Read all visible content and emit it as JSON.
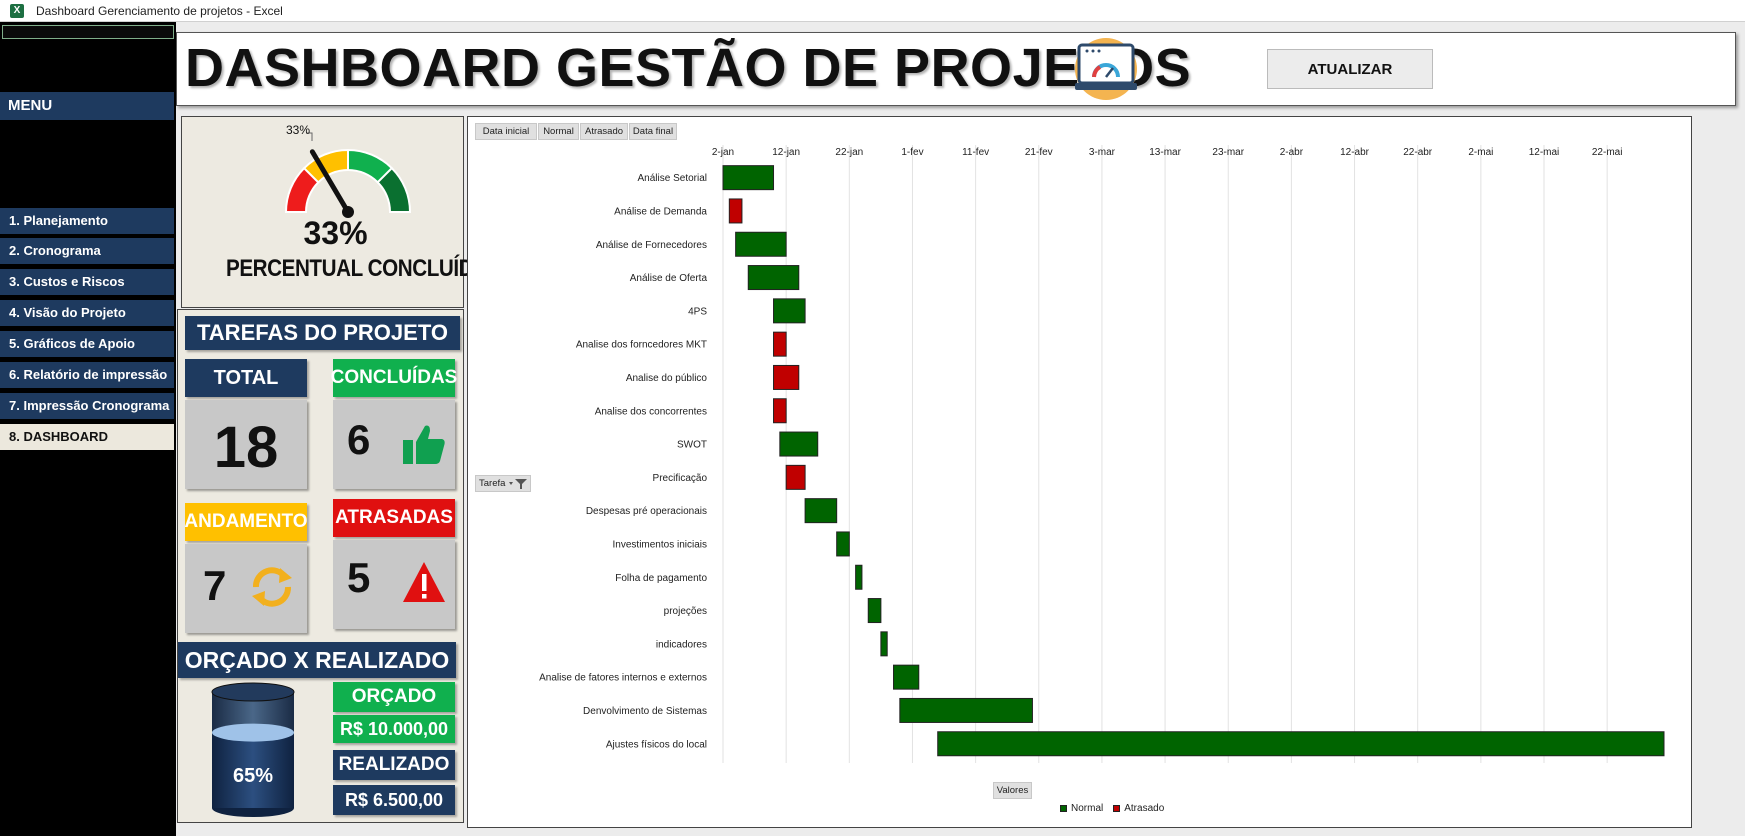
{
  "window": {
    "title": "Dashboard Gerenciamento de projetos - Excel",
    "app_icon": "X"
  },
  "sidebar": {
    "menu_label": "MENU",
    "items": [
      {
        "label": "1. Planejamento"
      },
      {
        "label": "2. Cronograma"
      },
      {
        "label": "3. Custos e Riscos"
      },
      {
        "label": "4. Visão do Projeto"
      },
      {
        "label": "5. Gráficos de Apoio"
      },
      {
        "label": "6. Relatório de impressão"
      },
      {
        "label": "7. Impressão Cronograma"
      },
      {
        "label": "8. DASHBOARD"
      }
    ]
  },
  "header": {
    "title": "DASHBOARD GESTÃO DE PROJETOS",
    "refresh_label": "ATUALIZAR"
  },
  "gauge": {
    "percent": 33,
    "percent_label": "33%",
    "value_label": "33%",
    "caption": "PERCENTUAL CONCLUÍDO"
  },
  "tasks": {
    "title": "TAREFAS DO PROJETO",
    "total_label": "TOTAL",
    "total_value": "18",
    "done_label": "CONCLUÍDAS",
    "done_value": "6",
    "progress_label": "ANDAMENTO",
    "progress_value": "7",
    "late_label": "ATRASADAS",
    "late_value": "5"
  },
  "budget": {
    "title": "ORÇADO X REALIZADO",
    "fill_percent": 65,
    "percent_label": "65%",
    "budget_label": "ORÇADO",
    "budget_value": "R$ 10.000,00",
    "actual_label": "REALIZADO",
    "actual_value": "R$ 6.500,00"
  },
  "colors": {
    "navy": "#1e3a5f",
    "green": "#10b04e",
    "yellow": "#ffc000",
    "red": "#e01010",
    "bar_normal": "#006400",
    "bar_late": "#c00000"
  },
  "chart_filters": {
    "buttons": [
      "Data inicial",
      "Normal",
      "Atrasado",
      "Data final"
    ],
    "row_field": "Tarefa",
    "values_label": "Valores"
  },
  "chart_data": {
    "type": "bar",
    "orientation": "horizontal-gantt",
    "x_ticks": [
      "2-jan",
      "12-jan",
      "22-jan",
      "1-fev",
      "11-fev",
      "21-fev",
      "3-mar",
      "13-mar",
      "23-mar",
      "2-abr",
      "12-abr",
      "22-abr",
      "2-mai",
      "12-mai",
      "22-mai"
    ],
    "x_tick_dates": [
      "2022-01-02",
      "2022-01-12",
      "2022-01-22",
      "2022-02-01",
      "2022-02-11",
      "2022-02-21",
      "2022-03-03",
      "2022-03-13",
      "2022-03-23",
      "2022-04-02",
      "2022-04-12",
      "2022-04-22",
      "2022-05-02",
      "2022-05-12",
      "2022-05-22"
    ],
    "xlim": [
      "2022-01-02",
      "2022-05-31"
    ],
    "legend": [
      "Normal",
      "Atrasado"
    ],
    "legend_position": "bottom",
    "grid": true,
    "tasks": [
      {
        "name": "Análise Setorial",
        "start": "2022-01-02",
        "end": "2022-01-10",
        "status": "Normal"
      },
      {
        "name": "Análise de Demanda",
        "start": "2022-01-03",
        "end": "2022-01-05",
        "status": "Atrasado"
      },
      {
        "name": "Análise de Fornecedores",
        "start": "2022-01-04",
        "end": "2022-01-12",
        "status": "Normal"
      },
      {
        "name": "Análise de Oferta",
        "start": "2022-01-06",
        "end": "2022-01-14",
        "status": "Normal"
      },
      {
        "name": "4PS",
        "start": "2022-01-10",
        "end": "2022-01-15",
        "status": "Normal"
      },
      {
        "name": "Analise dos forncedores MKT",
        "start": "2022-01-10",
        "end": "2022-01-12",
        "status": "Atrasado"
      },
      {
        "name": "Analise do público",
        "start": "2022-01-10",
        "end": "2022-01-14",
        "status": "Atrasado"
      },
      {
        "name": "Analise dos concorrentes",
        "start": "2022-01-10",
        "end": "2022-01-12",
        "status": "Atrasado"
      },
      {
        "name": "SWOT",
        "start": "2022-01-11",
        "end": "2022-01-17",
        "status": "Normal"
      },
      {
        "name": "Precificação",
        "start": "2022-01-12",
        "end": "2022-01-15",
        "status": "Atrasado"
      },
      {
        "name": "Despesas pré operacionais",
        "start": "2022-01-15",
        "end": "2022-01-20",
        "status": "Normal"
      },
      {
        "name": "Investimentos iniciais",
        "start": "2022-01-20",
        "end": "2022-01-22",
        "status": "Normal"
      },
      {
        "name": "Folha de pagamento",
        "start": "2022-01-23",
        "end": "2022-01-24",
        "status": "Normal"
      },
      {
        "name": "projeções",
        "start": "2022-01-25",
        "end": "2022-01-27",
        "status": "Normal"
      },
      {
        "name": "indicadores",
        "start": "2022-01-27",
        "end": "2022-01-28",
        "status": "Normal"
      },
      {
        "name": "Analise de fatores internos e externos",
        "start": "2022-01-29",
        "end": "2022-02-02",
        "status": "Normal"
      },
      {
        "name": "Denvolvimento de Sistemas",
        "start": "2022-01-30",
        "end": "2022-02-20",
        "status": "Normal"
      },
      {
        "name": "Ajustes físicos do local",
        "start": "2022-02-05",
        "end": "2022-05-31",
        "status": "Normal"
      }
    ]
  }
}
